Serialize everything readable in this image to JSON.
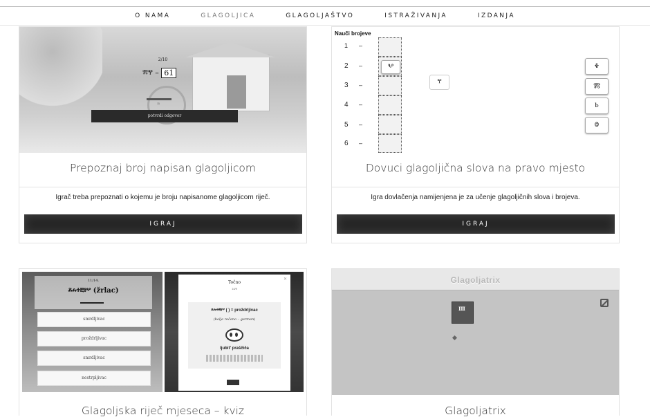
{
  "nav": {
    "items": [
      {
        "label": "O NAMA"
      },
      {
        "label": "GLAGOLJICA"
      },
      {
        "label": "GLAGOLJAŠTVO"
      },
      {
        "label": "ISTRAŽIVANJA"
      },
      {
        "label": "IZDANJA"
      }
    ]
  },
  "cards": [
    {
      "title": "Prepoznaj broj napisan glagoljicom",
      "description": "Igrač treba prepoznati o kojemu je broju napisanome glagoljicom riječ.",
      "button": "IGRAJ",
      "thumb": {
        "counter": "2/10",
        "glyph": "ⰿⰹ",
        "answer": "61",
        "small": "11",
        "confirm": "potvrdi odgovor"
      }
    },
    {
      "title": "Dovuci glagoljična slova na pravo mjesto",
      "description": "Igra dovlačenja namijenjena je za učenje glagoljičnih slova i brojeva.",
      "button": "IGRAJ",
      "thumb": {
        "heading": "Nauči brojeve",
        "numbers": [
          "1",
          "2",
          "3",
          "4",
          "5",
          "6"
        ],
        "dash": "–",
        "placed": "Ⰲ",
        "floating": "ⰹ",
        "tiles": [
          "Ⰷ",
          "Ⰿ",
          "Ⱃ",
          "Ⱉ"
        ]
      }
    },
    {
      "title": "Glagoljska riječ mjeseca – kviz",
      "thumb": {
        "counter": "11/14.",
        "word": "ⰶⰾⰰⰱⱁⰲ (žrlac)",
        "options": [
          "smrdljivac",
          "proždrljivac",
          "smrdljivac",
          "nestrpljivac"
        ],
        "popup_title": "Točno",
        "popup_sub": "14/9",
        "popup_line1": "ⰶⰾⰰⰱⱁⰲ ( ) = proždrljivac",
        "popup_line2": "(bolje rečeno – garman)",
        "popup_line3": "ljubit' praščiča"
      }
    },
    {
      "title": "Glagoljatrix",
      "thumb": {
        "header": "Glagoljatrix",
        "piece": "Ⱎ"
      }
    }
  ],
  "colors": {
    "button": "#262626",
    "nav_active": "#777777",
    "border": "#e2e2e2"
  }
}
